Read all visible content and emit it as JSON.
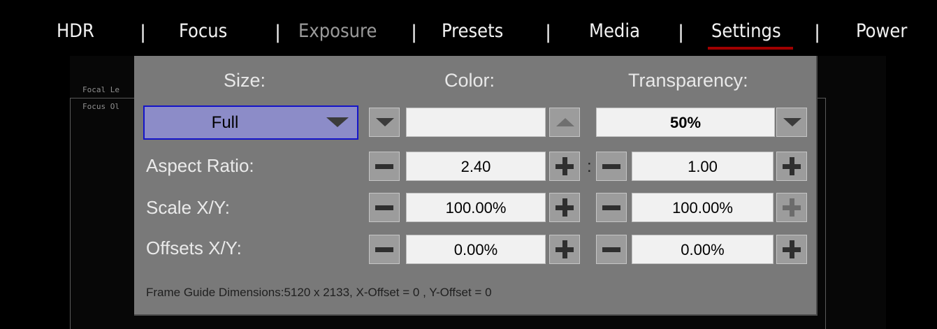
{
  "nav": {
    "tabs": [
      {
        "label": "HDR"
      },
      {
        "label": "Focus"
      },
      {
        "label": "Exposure"
      },
      {
        "label": "Presets"
      },
      {
        "label": "Media"
      },
      {
        "label": "Settings"
      },
      {
        "label": "Power"
      }
    ],
    "separator": "|",
    "active_tab": "Settings",
    "disabled_tab": "Exposure",
    "active_color": "#a00000"
  },
  "background": {
    "focal_label": "Focal Le",
    "focus_label": "Focus Ol"
  },
  "dialog": {
    "headers": {
      "size": "Size:",
      "color": "Color:",
      "transparency": "Transparency:"
    },
    "size_select": {
      "value": "Full",
      "highlight_color": "#8c8cc8",
      "border_color": "#1414c8"
    },
    "color_value": "",
    "transparency_value": "50%",
    "rows": {
      "aspect_ratio": {
        "label": "Aspect Ratio:",
        "value_x": "2.40",
        "separator": ":",
        "value_y": "1.00"
      },
      "scale": {
        "label": "Scale X/Y:",
        "value_x": "100.00%",
        "value_y": "100.00%"
      },
      "offsets": {
        "label": "Offsets X/Y:",
        "value_x": "0.00%",
        "value_y": "0.00%"
      }
    },
    "footer": "Frame Guide Dimensions:5120 x 2133, X-Offset = 0 , Y-Offset = 0"
  }
}
